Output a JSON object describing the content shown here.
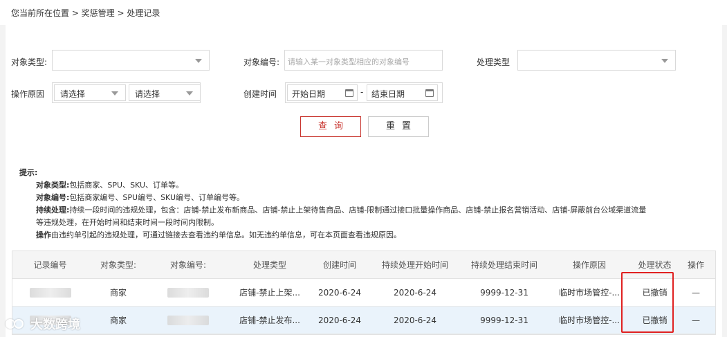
{
  "breadcrumb": "您当前所在位置 > 奖惩管理 > 处理记录",
  "filters": {
    "object_type_label": "对象类型:",
    "object_type_value": "",
    "object_code_label": "对象编号:",
    "object_code_placeholder": "请输入某一对象类型相应的对象编号",
    "handle_type_label": "处理类型",
    "handle_type_value": "",
    "reason_label": "操作原因",
    "reason_select_1": "请选择",
    "reason_select_2": "请选择",
    "created_label": "创建时间",
    "start_date": "开始日期",
    "date_sep": "-",
    "end_date": "结束日期"
  },
  "buttons": {
    "query": "查询",
    "reset": "重置"
  },
  "tips": {
    "title": "提示:",
    "lines": [
      {
        "key": "对象类型:",
        "text": "包括商家、SPU、SKU、订单等。"
      },
      {
        "key": "对象编号:",
        "text": "包括商家编号、SPU编号、SKU编号、订单编号等。"
      },
      {
        "key": "持续处理:",
        "text": "持续一段时间的违规处理，包含：店铺-禁止发布新商品、店铺-禁止上架待售商品、店铺-限制通过接口批量操作商品、店铺-禁止报名营销活动、店铺-屏蔽前台公域渠道流量"
      },
      {
        "key": "",
        "text": "等违规处理，在开始时间和结束时间一段时间内限制。"
      },
      {
        "key": "操作",
        "text": "由违约单引起的违规处理，可通过链接去查看违约单信息。如无违约单信息，可在本页面查看违规原因。"
      }
    ]
  },
  "table": {
    "columns": [
      "记录编号",
      "对象类型:",
      "对象编号:",
      "处理类型",
      "创建时间",
      "持续处理开始时间",
      "持续处理结束时间",
      "操作原因",
      "处理状态",
      "操作"
    ],
    "rows": [
      [
        "",
        "商家",
        "",
        "店铺-禁止上架...",
        "2020-6-24",
        "2020-6-24",
        "9999-12-31",
        "临时市场管控-...",
        "已撤销",
        "—"
      ],
      [
        "",
        "商家",
        "",
        "店铺-禁止发布...",
        "2020-6-24",
        "2020-6-24",
        "9999-12-31",
        "临时市场管控-...",
        "已撤销",
        "—"
      ]
    ]
  },
  "watermark": "大数跨境",
  "colors": {
    "accent_red": "#c8342e",
    "highlight_red": "#e02020",
    "row_alt": "#eaf3fb"
  }
}
